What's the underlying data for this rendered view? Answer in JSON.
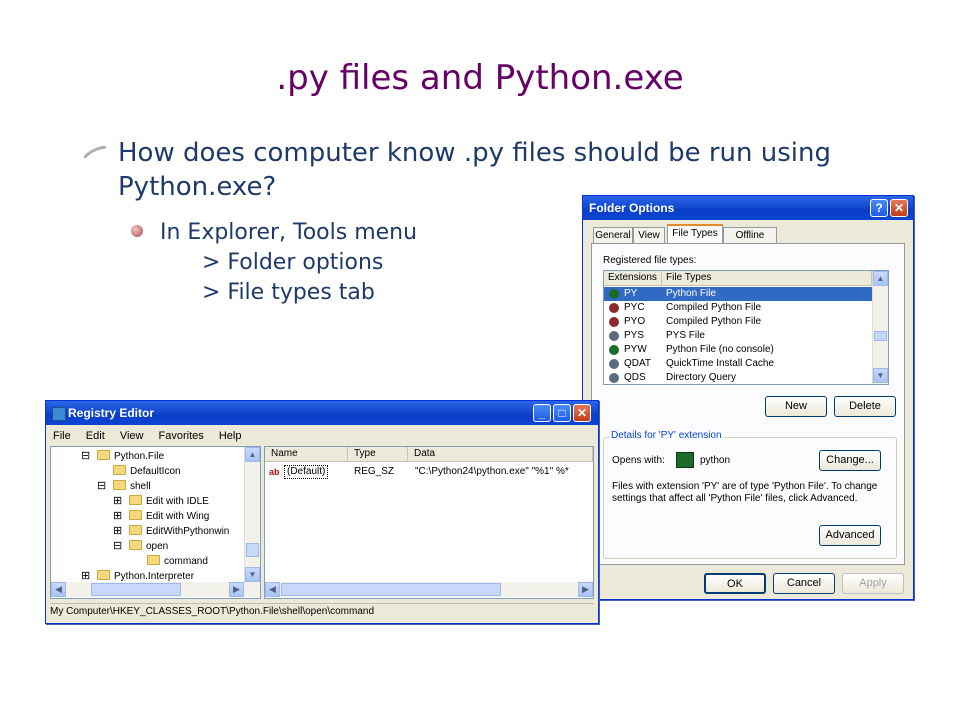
{
  "slide": {
    "title": ".py files and Python.exe",
    "bullet1": "How does computer know .py files should be run using Python.exe?",
    "bullet2": "In Explorer, Tools menu\n      > Folder options\n      > File types tab"
  },
  "folder_options": {
    "title": "Folder Options",
    "help_glyph": "?",
    "close_glyph": "✕",
    "tabs": [
      "General",
      "View",
      "File Types",
      "Offline Files"
    ],
    "registered_label": "Registered file types:",
    "columns": [
      "Extensions",
      "File Types"
    ],
    "rows": [
      {
        "ext": "PY",
        "desc": "Python File",
        "selected": true
      },
      {
        "ext": "PYC",
        "desc": "Compiled Python File"
      },
      {
        "ext": "PYO",
        "desc": "Compiled Python File"
      },
      {
        "ext": "PYS",
        "desc": "PYS File"
      },
      {
        "ext": "PYW",
        "desc": "Python File (no console)"
      },
      {
        "ext": "QDAT",
        "desc": "QuickTime Install Cache"
      },
      {
        "ext": "QDS",
        "desc": "Directory Query"
      }
    ],
    "new_label": "New",
    "delete_label": "Delete",
    "details_label": "Details for 'PY' extension",
    "opens_with_label": "Opens with:",
    "opens_with_value": "python",
    "change_label": "Change...",
    "details_text": "Files with extension 'PY' are of type 'Python File'.  To change settings that affect all 'Python File' files, click Advanced.",
    "advanced_label": "Advanced",
    "ok_label": "OK",
    "cancel_label": "Cancel",
    "apply_label": "Apply"
  },
  "registry": {
    "title": "Registry Editor",
    "menu": [
      "File",
      "Edit",
      "View",
      "Favorites",
      "Help"
    ],
    "tree": [
      {
        "label": "Python.File",
        "expander": "⊟"
      },
      {
        "label": "DefaultIcon",
        "expander": ""
      },
      {
        "label": "shell",
        "expander": "⊟"
      },
      {
        "label": "Edit with IDLE",
        "expander": "⊞"
      },
      {
        "label": "Edit with Wing",
        "expander": "⊞"
      },
      {
        "label": "EditWithPythonwin",
        "expander": "⊞"
      },
      {
        "label": "open",
        "expander": "⊟"
      },
      {
        "label": "command",
        "expander": ""
      },
      {
        "label": "Python.Interpreter",
        "expander": "⊞"
      }
    ],
    "columns": [
      "Name",
      "Type",
      "Data"
    ],
    "values": [
      {
        "name": "(Default)",
        "type": "REG_SZ",
        "data": "\"C:\\Python24\\python.exe\" \"%1\" %*"
      }
    ],
    "status": "My Computer\\HKEY_CLASSES_ROOT\\Python.File\\shell\\open\\command",
    "value_icon_text": "ab"
  },
  "colors": {
    "title": "#660066",
    "body_text": "#1f3a6a",
    "xp_title_bar": "#0a3fc8",
    "selection": "#316ac5"
  }
}
